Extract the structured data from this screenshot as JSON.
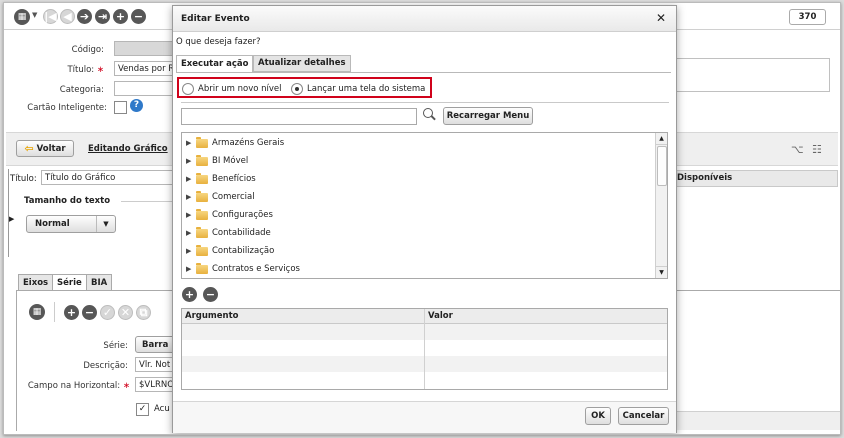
{
  "background": {
    "counter": "370",
    "form": {
      "codigo_label": "Código:",
      "titulo_label": "Título:",
      "titulo_value": "Vendas por R",
      "categoria_label": "Categoria:",
      "cartao_label": "Cartão Inteligente:",
      "required_mark": "∗"
    },
    "subtoolbar": {
      "voltar": "Voltar",
      "editando": "Editando Gráfico"
    },
    "chart_panel": {
      "titulo_label": "Título:",
      "titulo_value": "Título do Gráfico",
      "tamanho_label": "Tamanho do texto",
      "tamanho_value": "Normal",
      "disponiveis": "Disponíveis"
    },
    "tabs": [
      "Eixos",
      "Série",
      "BIA"
    ],
    "serie": {
      "serie_label": "Série:",
      "serie_value": "Barra",
      "descricao_label": "Descrição:",
      "descricao_value": "Vlr. Not",
      "campo_label": "Campo na Horizontal:",
      "campo_value": "$VLRNO",
      "acu_label": "Acu"
    }
  },
  "dialog": {
    "title": "Editar Evento",
    "close": "✕",
    "prompt": "O que deseja fazer?",
    "tabs": [
      "Executar ação",
      "Atualizar detalhes"
    ],
    "radios": [
      {
        "label": "Abrir um novo nível",
        "checked": false
      },
      {
        "label": "Lançar uma tela do sistema",
        "checked": true
      }
    ],
    "highlight_color": "#d0021b",
    "search_placeholder": "",
    "reload_button": "Recarregar Menu",
    "tree": [
      "Armazéns Gerais",
      "BI Móvel",
      "Benefícios",
      "Comercial",
      "Configurações",
      "Contabilidade",
      "Contabilização",
      "Contratos e Serviços"
    ],
    "table_headers": [
      "Argumento",
      "Valor"
    ],
    "ok": "OK",
    "cancel": "Cancelar"
  }
}
